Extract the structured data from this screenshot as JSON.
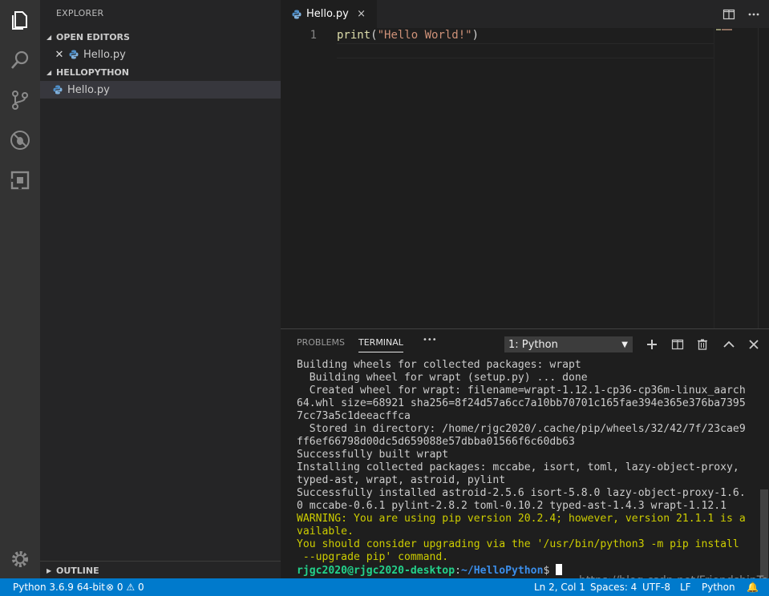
{
  "activity_bar": {
    "icons": [
      "files-icon",
      "search-icon",
      "source-control-icon",
      "debug-icon",
      "extensions-icon"
    ],
    "settings_icon": "gear-icon"
  },
  "sidebar": {
    "title": "EXPLORER",
    "open_editors": {
      "label": "OPEN EDITORS",
      "files": [
        {
          "name": "Hello.py"
        }
      ]
    },
    "project": {
      "label": "HELLOPYTHON",
      "files": [
        {
          "name": "Hello.py"
        }
      ]
    },
    "outline_label": "OUTLINE"
  },
  "editor": {
    "tab_label": "Hello.py",
    "tab_close": "×",
    "lines": [
      {
        "number": "1",
        "fn": "print",
        "open": "(",
        "str": "\"Hello World!\"",
        "close": ")"
      }
    ]
  },
  "panel": {
    "tabs": [
      {
        "label": "PROBLEMS"
      },
      {
        "label": "TERMINAL"
      }
    ],
    "more": "•••",
    "terminal_select": "1: Python",
    "terminal_lines": [
      "Building wheels for collected packages: wrapt",
      "  Building wheel for wrapt (setup.py) ... done",
      "  Created wheel for wrapt: filename=wrapt-1.12.1-cp36-cp36m-linux_aarch",
      "64.whl size=68921 sha256=8f24d57a6cc7a10bb70701c165fae394e365e376ba7395",
      "7cc73a5c1deeacffca",
      "  Stored in directory: /home/rjgc2020/.cache/pip/wheels/32/42/7f/23cae9",
      "ff6ef66798d00dc5d659088e57dbba01566f6c60db63",
      "Successfully built wrapt",
      "Installing collected packages: mccabe, isort, toml, lazy-object-proxy,",
      "typed-ast, wrapt, astroid, pylint",
      "Successfully installed astroid-2.5.6 isort-5.8.0 lazy-object-proxy-1.6.",
      "0 mccabe-0.6.1 pylint-2.8.2 toml-0.10.2 typed-ast-1.4.3 wrapt-1.12.1"
    ],
    "warning_lines": [
      "WARNING: You are using pip version 20.2.4; however, version 21.1.1 is a",
      "vailable.",
      "You should consider upgrading via the '/usr/bin/python3 -m pip install",
      " --upgrade pip' command."
    ],
    "prompt_user": "rjgc2020@rjgc2020-desktop",
    "prompt_colon": ":",
    "prompt_path": "~/HelloPython",
    "prompt_symbol": "$"
  },
  "watermark": "https://blog.csdn.net/FriendshipTang",
  "status_bar": {
    "interpreter": "Python 3.6.9 64-bit",
    "errors": "0",
    "warnings": "0",
    "position": "Ln 2, Col 1",
    "spaces": "Spaces: 4",
    "encoding": "UTF-8",
    "eol": "LF",
    "language": "Python"
  }
}
